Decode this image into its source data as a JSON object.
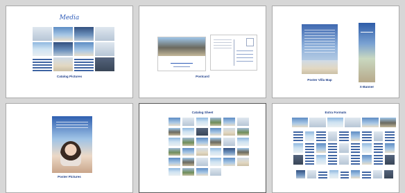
{
  "panels": {
    "media": {
      "title": "Media",
      "caption": "Catalog Pictures"
    },
    "postcard": {
      "caption": "Postcard"
    },
    "poster_map": {
      "caption": "Poster Villa Map"
    },
    "banner": {
      "caption": "X-Banner"
    },
    "poster_pictures": {
      "caption": "Poster Pictures"
    },
    "catalog_sheet": {
      "caption": "Catalog Sheet"
    },
    "extra_formats": {
      "caption": "Extra Formats"
    }
  },
  "colors": {
    "accent": "#1f3f8a",
    "panel": "#ffffff",
    "background": "#d7d7d7",
    "border": "#a9a9a9"
  }
}
